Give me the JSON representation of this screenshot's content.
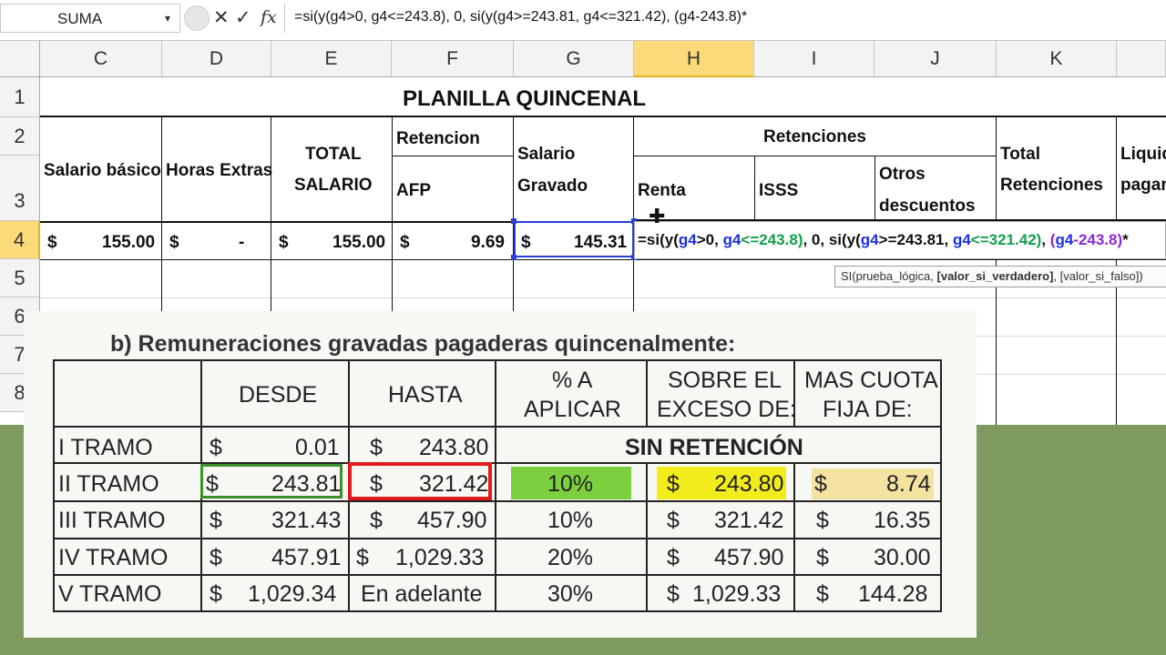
{
  "formula_bar": {
    "name_box": "SUMA",
    "dropdown": "▾",
    "cancel": "✕",
    "enter": "✓",
    "fx": "fx",
    "formula": "=si(y(g4>0, g4<=243.8), 0, si(y(g4>=243.81, g4<=321.42), (g4-243.8)*"
  },
  "columns": [
    "C",
    "D",
    "E",
    "F",
    "G",
    "H",
    "I",
    "J",
    "K"
  ],
  "rows": [
    "1",
    "2",
    "3",
    "4",
    "5",
    "6",
    "7",
    "8"
  ],
  "sheet": {
    "title": "PLANILLA QUINCENAL",
    "headers": {
      "salario_basico": "Salario básico",
      "horas_extras": "Horas Extras",
      "total_salario_1": "TOTAL",
      "total_salario_2": "SALARIO",
      "retencion": "Retencion",
      "afp": "AFP",
      "salario_gravado_1": "Salario",
      "salario_gravado_2": "Gravado",
      "retenciones": "Retenciones",
      "renta": "Renta",
      "isss": "ISSS",
      "otros_1": "Otros",
      "otros_2": "descuentos",
      "total_ret_1": "Total",
      "total_ret_2": "Retenciones",
      "liquido_1": "Liquido",
      "liquido_2": "pagar"
    },
    "row4": {
      "currency": "$",
      "salario_basico": "155.00",
      "horas_extras": "-",
      "total_salario": "155.00",
      "afp": "9.69",
      "salario_gravado": "145.31"
    },
    "editing_formula": {
      "p1": "=si(y(",
      "g4a": "g4",
      "p2": ">0, ",
      "g4b": "g4",
      "p3": "<=243.8)",
      "p4": ", 0, si(y(",
      "g4c": "g4",
      "p5": ">=243.81, ",
      "g4d": "g4",
      "p6": "<=321.42)",
      "p7": ", ",
      "p8": "(",
      "g4e": "g4",
      "p9": "-243.8)",
      "p10": "*"
    },
    "tooltip": {
      "a": "SI(prueba_lógica, ",
      "b": "[valor_si_verdadero]",
      "c": ", [valor_si_falso])"
    }
  },
  "scan": {
    "title": "b) Remuneraciones gravadas pagaderas quincenalmente:",
    "headers": {
      "desde": "DESDE",
      "hasta": "HASTA",
      "pct_1": "% A",
      "pct_2": "APLICAR",
      "sobre_1": "SOBRE EL",
      "sobre_2": "EXCESO DE:",
      "cuota_1": "MAS CUOTA",
      "cuota_2": "FIJA DE:"
    },
    "sin_retencion": "SIN RETENCIÓN",
    "rows": [
      {
        "tramo": "I   TRAMO",
        "desde": "0.01",
        "hasta": "243.80"
      },
      {
        "tramo": "II  TRAMO",
        "desde": "243.81",
        "hasta": "321.42",
        "pct": "10%",
        "sobre": "243.80",
        "cuota": "8.74"
      },
      {
        "tramo": "III TRAMO",
        "desde": "321.43",
        "hasta": "457.90",
        "pct": "10%",
        "sobre": "321.42",
        "cuota": "16.35"
      },
      {
        "tramo": "IV  TRAMO",
        "desde": "457.91",
        "hasta": "1,029.33",
        "pct": "20%",
        "sobre": "457.90",
        "cuota": "30.00"
      },
      {
        "tramo": "V   TRAMO",
        "desde": "1,029.34",
        "hasta": "En adelante",
        "pct": "30%",
        "sobre": "1,029.33",
        "cuota": "144.28"
      }
    ],
    "currency": "$"
  },
  "colors": {
    "selected_header": "#fbdb79",
    "active_border": "#2a3fd6",
    "highlight_green_box": "#3f8f2a",
    "highlight_red_box": "#e11b1b",
    "green_fill": "#7ccf3f",
    "yellow_fill": "#f2ec1c",
    "tan_fill": "#f3e2a0",
    "background_strip": "#7f9a5f"
  }
}
